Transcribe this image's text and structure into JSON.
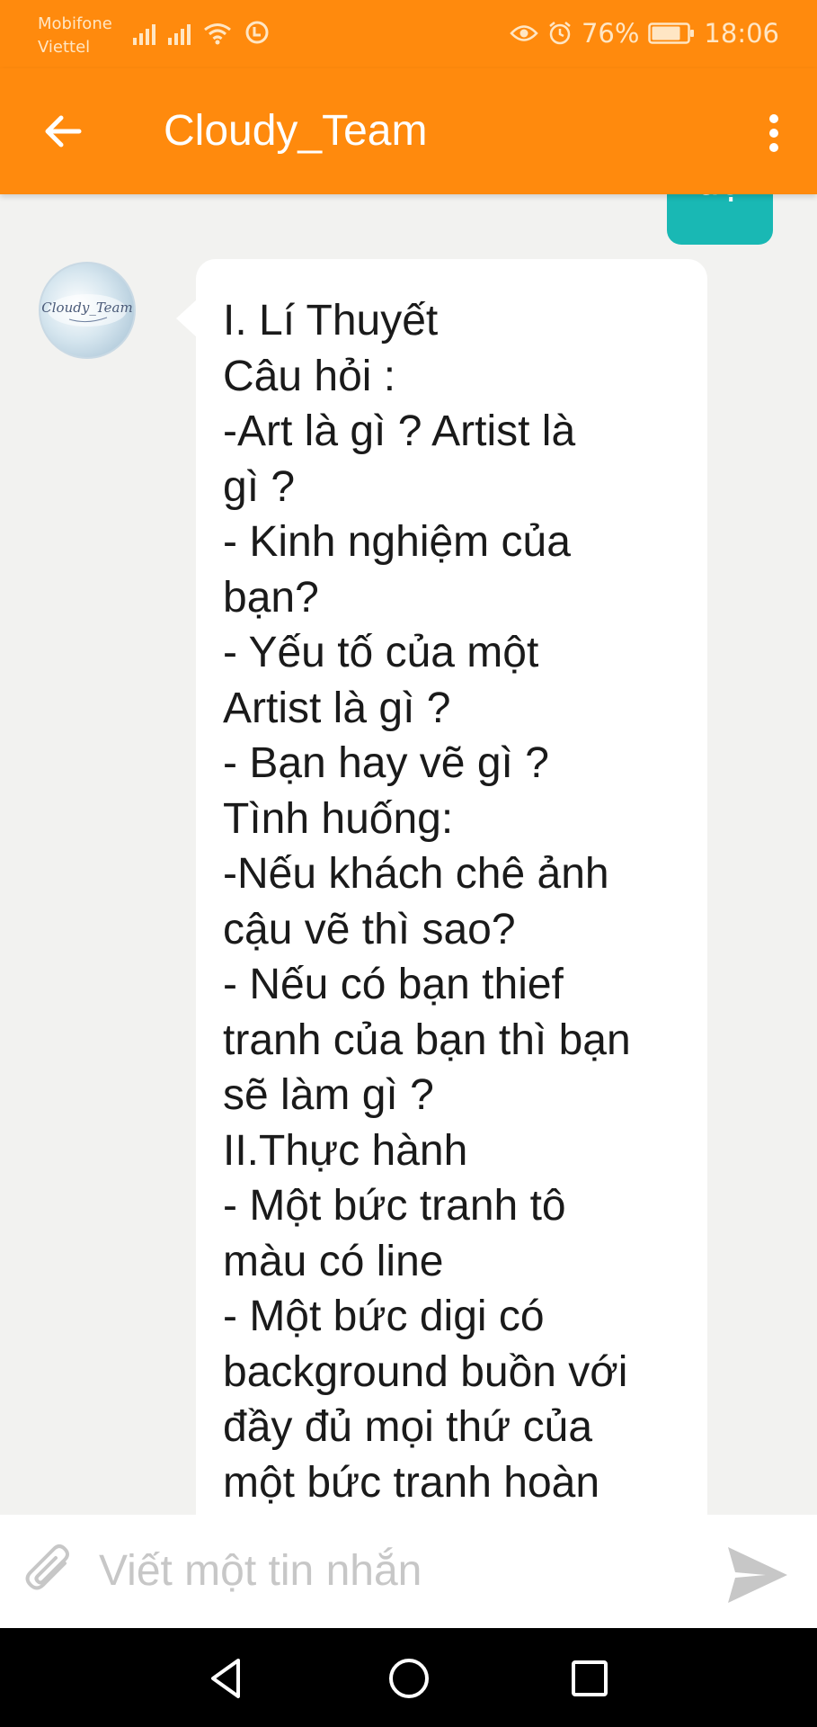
{
  "status_bar": {
    "carrier_1": "Mobifone",
    "carrier_2": "Viettel",
    "battery": "76%",
    "time": "18:06",
    "icons": [
      "signal-icon",
      "signal-icon",
      "wifi-icon",
      "data-saver-icon",
      "eye-comfort-icon",
      "alarm-icon",
      "battery-icon"
    ]
  },
  "app_bar": {
    "title": "Cloudy_Team",
    "back_icon": "arrow-left-icon",
    "menu_icon": "more-vertical-icon"
  },
  "messages": {
    "sent": {
      "text": "dạ"
    },
    "received": {
      "avatar_logo_text": "Cloudy_Team",
      "text": "I. Lí Thuyết\nCâu hỏi :\n-Art là gì ? Artist là\ngì ?\n- Kinh nghiệm của\nbạn?\n- Yếu tố của một\nArtist là gì ?\n- Bạn hay vẽ gì ?\nTình huống:\n-Nếu khách chê ảnh\ncậu vẽ thì sao?\n- Nếu có bạn thief\ntranh của bạn thì bạn\nsẽ làm gì ?\nII.Thực hành\n- Một bức tranh tô\nmàu có line\n- Một bức digi có\nbackground buồn với\nđầy đủ mọi thứ của\nmột bức tranh hoàn"
    }
  },
  "composer": {
    "placeholder": "Viết một tin nhắn",
    "value": "",
    "attach_icon": "paperclip-icon",
    "send_icon": "send-icon"
  },
  "nav": {
    "icons": [
      "back-triangle-icon",
      "home-circle-icon",
      "recents-square-icon"
    ]
  },
  "colors": {
    "accent": "#ff8a0d",
    "sent_bubble": "#19b8b4",
    "received_bubble": "#ffffff",
    "background": "#f2f2f0"
  }
}
